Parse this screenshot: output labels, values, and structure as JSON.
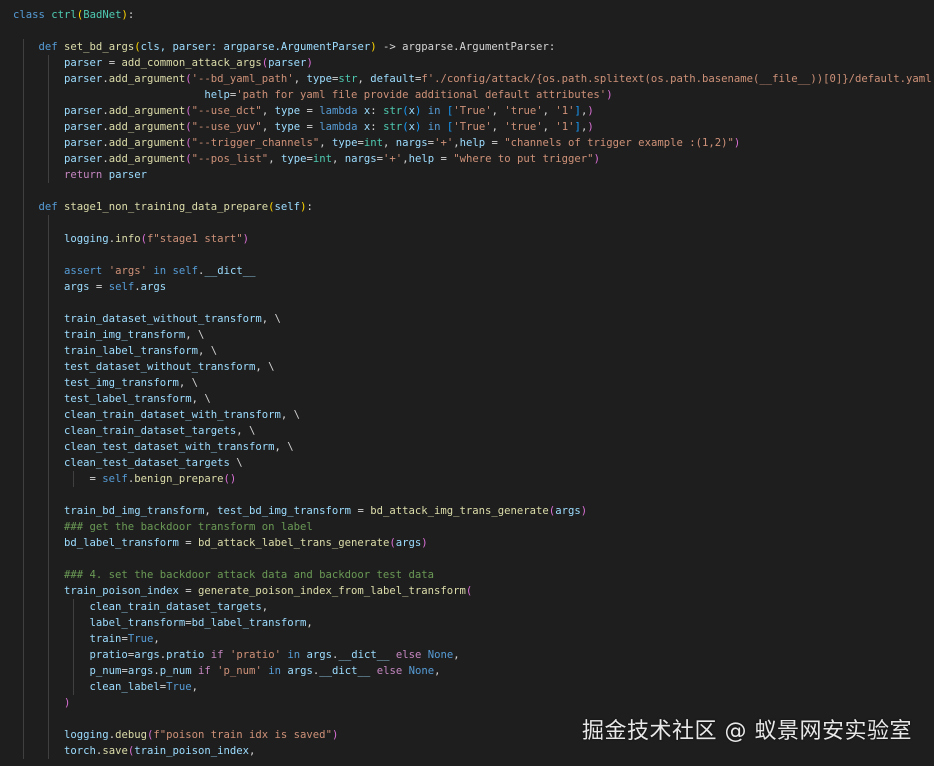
{
  "code": {
    "class_kw": "class",
    "class_name": "ctrl",
    "base_class": "BadNet",
    "def_kw": "def",
    "method1_name": "set_bd_args",
    "method1_params": "cls, parser: argparse.ArgumentParser",
    "method1_return": "argparse.ArgumentParser",
    "line_parser_assign": "add_common_attack_args",
    "bd_yaml_path_flag": "'--bd_yaml_path'",
    "bd_yaml_default": "f'./config/attack/{os.path.splitext(os.path.basename(__file__))[0]}/default.yaml'",
    "bd_yaml_help": "'path for yaml file provide additional default attributes'",
    "use_dct_flag": "\"--use_dct\"",
    "use_yuv_flag": "\"--use_yuv\"",
    "trigger_channels_flag": "\"--trigger_channels\"",
    "trigger_channels_help": "\"channels of trigger example :(1,2)\"",
    "pos_list_flag": "\"--pos_list\"",
    "pos_list_help": "\"where to put trigger\"",
    "return_kw": "return",
    "method2_name": "stage1_non_training_data_prepare",
    "logging_info_str": "f\"stage1 start\"",
    "assert_str": "'args'",
    "comment_backdoor_transform": "### get the backdoor transform on label",
    "comment_set_data": "### 4. set the backdoor attack data and backdoor test data",
    "logging_debug_str": "f\"poison train idx is saved\"",
    "pratio_str": "'pratio'",
    "pnum_str": "'p_num'"
  },
  "watermark": "掘金技术社区 @ 蚁景网安实验室",
  "colors": {
    "background": "#1e1e1e",
    "keyword": "#569cd6",
    "control_keyword": "#c586c0",
    "function": "#dcdcaa",
    "class": "#4ec9b0",
    "variable": "#9cdcfe",
    "string": "#ce9178",
    "comment": "#6a9955"
  }
}
